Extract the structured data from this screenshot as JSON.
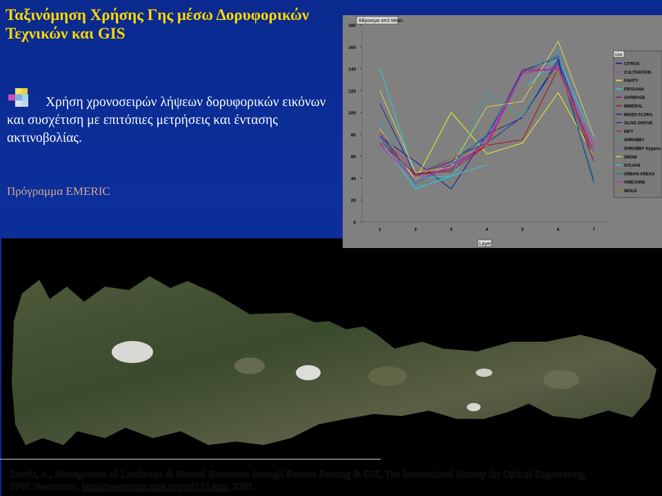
{
  "slide": {
    "title": "Ταξινόμηση Χρήσης Γης μέσω Δορυφορικών Τεχνικών και GIS",
    "body": "Χρήση χρονοσειρών λήψεων δορυφορικών εικόνων και συσχέτιση με επιτόπιες μετρήσεις και έντασης ακτινοβολίας.",
    "program": "Πρόγραμμα EMERIC",
    "bullet_icon": "colored-squares-icon",
    "citation": {
      "author": "Sarris, A.,",
      "text": " Management of Landscape & Natural Resources through Remote Sensing & GIS, The International Society for Optical Engineering,",
      "line2_prefix": "SPIE Newsroom, ",
      "link": "http://newsroom.spie.org/x6173.xml",
      "line2_suffix": ", 2007."
    },
    "map_image": "satellite-image-of-crete"
  },
  "chart_data": {
    "type": "line",
    "title": "Άθροισμα από Mean",
    "xlabel": "Layer",
    "legend_title": "use",
    "x": [
      1,
      2,
      3,
      4,
      5,
      6,
      7
    ],
    "yticks": [
      0,
      20,
      40,
      60,
      80,
      100,
      120,
      140,
      160,
      180
    ],
    "ylim": [
      0,
      180
    ],
    "legend_position": "right",
    "series": [
      {
        "name": "CITRUS",
        "color": "#1a1aa0",
        "values": [
          78,
          55,
          30,
          80,
          95,
          148,
          35
        ]
      },
      {
        "name": "CULTIVATION",
        "color": "#c0389a",
        "values": [
          82,
          45,
          55,
          75,
          140,
          142,
          70
        ]
      },
      {
        "name": "FAVITY",
        "color": "#e8e830",
        "values": [
          85,
          38,
          100,
          62,
          72,
          118,
          60
        ]
      },
      {
        "name": "FRYGANA",
        "color": "#2ad0d0",
        "values": [
          140,
          40,
          42,
          80,
          120,
          150,
          75
        ]
      },
      {
        "name": "GARBAGE",
        "color": "#8a1a6a",
        "values": [
          75,
          42,
          48,
          72,
          138,
          140,
          65
        ]
      },
      {
        "name": "MINERAL",
        "color": "#b01818",
        "values": [
          72,
          44,
          46,
          70,
          75,
          140,
          62
        ]
      },
      {
        "name": "MIXED FLORA",
        "color": "#2a2a90",
        "values": [
          108,
          42,
          55,
          78,
          138,
          150,
          55
        ]
      },
      {
        "name": "OLIVE GROVE",
        "color": "#2a3a90",
        "values": [
          80,
          42,
          58,
          72,
          96,
          145,
          38
        ]
      },
      {
        "name": "RIFT",
        "color": "#a02070",
        "values": [
          78,
          42,
          52,
          70,
          136,
          140,
          55
        ]
      },
      {
        "name": "SHRUBBY",
        "color": "#3aa0a0",
        "values": [
          92,
          31,
          40,
          118,
          95,
          158,
          62
        ]
      },
      {
        "name": "SHRUBBY frygana",
        "color": "#7070c0",
        "values": [
          88,
          35,
          52,
          80,
          120,
          155,
          75
        ]
      },
      {
        "name": "SNOW",
        "color": "#d0d060",
        "values": [
          120,
          45,
          50,
          105,
          110,
          165,
          78
        ]
      },
      {
        "name": "SYLVAN",
        "color": "#30c8e0",
        "values": [
          75,
          30,
          42,
          52,
          null,
          null,
          null
        ]
      },
      {
        "name": "URBAN AREAS",
        "color": "#208090",
        "values": [
          80,
          35,
          52,
          80,
          136,
          152,
          35
        ]
      },
      {
        "name": "VINEYARD",
        "color": "#d020d0",
        "values": [
          70,
          38,
          50,
          72,
          136,
          140,
          65
        ]
      },
      {
        "name": "WOLD",
        "color": "#a08020",
        "values": [
          84,
          40,
          58,
          70,
          120,
          138,
          60
        ]
      }
    ]
  }
}
